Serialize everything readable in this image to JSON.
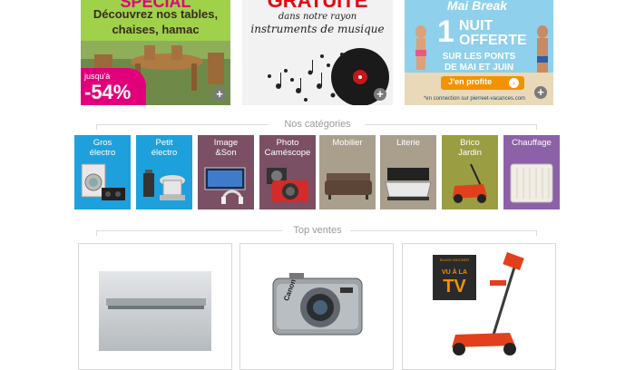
{
  "banners": [
    {
      "id": "garden",
      "top_text": "SPÉCIAL",
      "text": "Découvrez nos tables, chaises, hamac",
      "line1": "Découvrez nos tables,",
      "line2": "chaises, hamac",
      "discount_prefix": "jusqu'à",
      "discount": "-54%",
      "bg": "#9fd24a"
    },
    {
      "id": "music",
      "headline": "GRATUITE",
      "sub1": "dans notre rayon",
      "sub2": "instruments de musique",
      "bg": "#f2f2f2"
    },
    {
      "id": "mai-break",
      "brand": "Mai Break",
      "big_number": "1",
      "big_line1": "NUIT",
      "big_line2": "OFFERTE",
      "sub1": "SUR LES PONTS",
      "sub2": "DE MAI ET JUIN",
      "cta": "J'en profite",
      "footnote": "*en connection sur pierreet-vacances.com",
      "bg": "#7cc5e6"
    }
  ],
  "categories_title": "Nos catégories",
  "categories": [
    {
      "label1": "Gros",
      "label2": "électro",
      "color": "#1ea0dc",
      "icon": "washing-machine-icon"
    },
    {
      "label1": "Petit",
      "label2": "électro",
      "color": "#1ea0dc",
      "icon": "kitchen-robot-icon"
    },
    {
      "label1": "Image",
      "label2": "&Son",
      "color": "#7b4f64",
      "icon": "tv-headphones-icon"
    },
    {
      "label1": "Photo",
      "label2": "Caméscope",
      "color": "#7b4f64",
      "icon": "camera-icon"
    },
    {
      "label1": "Mobilier",
      "label2": "",
      "color": "#aa9f8d",
      "icon": "sofa-icon"
    },
    {
      "label1": "Literie",
      "label2": "",
      "color": "#aa9f8d",
      "icon": "bed-icon"
    },
    {
      "label1": "Brico",
      "label2": "Jardin",
      "color": "#9a9d42",
      "icon": "lawnmower-icon"
    },
    {
      "label1": "Chauffage",
      "label2": "",
      "color": "#8c61a8",
      "icon": "radiator-icon"
    }
  ],
  "top_title": "Top ventes",
  "products": [
    {
      "id": "hood",
      "icon": "range-hood-icon"
    },
    {
      "id": "camera",
      "brand": "Canon",
      "icon": "compact-camera-icon"
    },
    {
      "id": "trimmer",
      "badge_brand": "BLACK+DECKER",
      "badge1": "VU À LA",
      "badge2": "TV",
      "icon": "grass-trimmer-icon"
    }
  ]
}
